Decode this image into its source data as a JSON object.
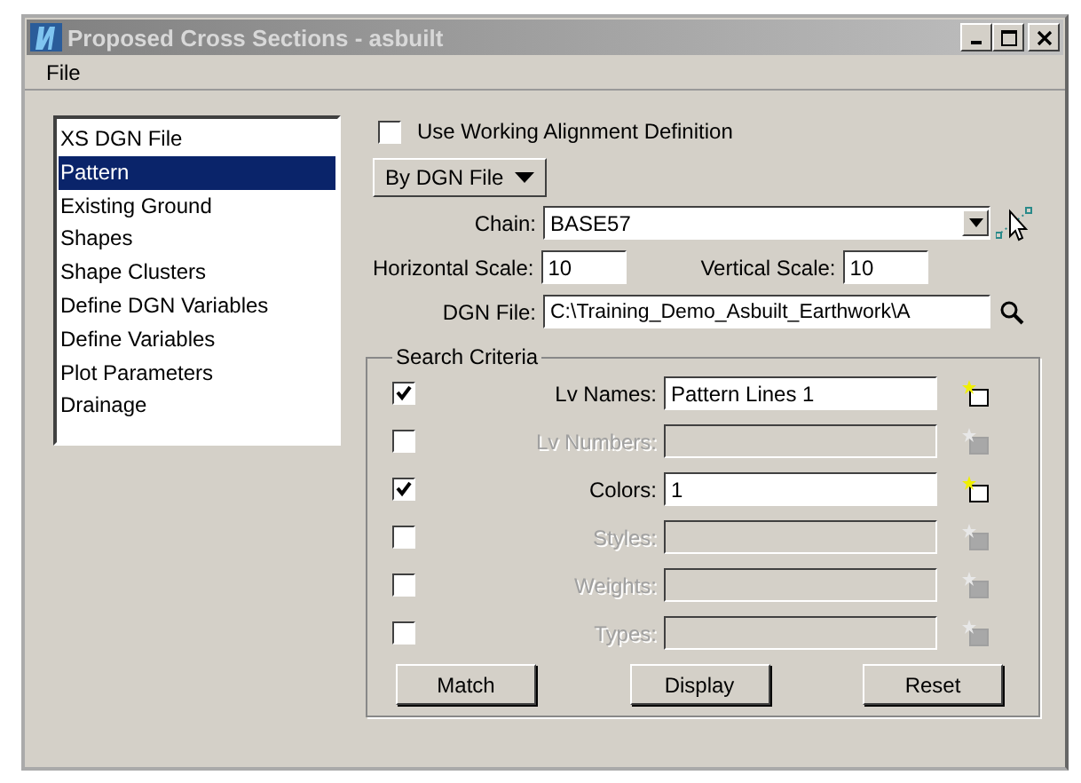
{
  "window": {
    "title": "Proposed Cross Sections - asbuilt"
  },
  "menu": [
    "File"
  ],
  "sidebar": {
    "items": [
      {
        "label": "XS DGN File",
        "selected": false
      },
      {
        "label": "Pattern",
        "selected": true
      },
      {
        "label": "Existing Ground",
        "selected": false
      },
      {
        "label": "Shapes",
        "selected": false
      },
      {
        "label": "Shape Clusters",
        "selected": false
      },
      {
        "label": "Define DGN Variables",
        "selected": false
      },
      {
        "label": "Define Variables",
        "selected": false
      },
      {
        "label": "Plot Parameters",
        "selected": false
      },
      {
        "label": "Drainage",
        "selected": false
      }
    ]
  },
  "use_working_alignment": {
    "label": "Use Working Alignment Definition",
    "checked": false
  },
  "mode_dropdown": {
    "value": "By DGN File"
  },
  "chain": {
    "label": "Chain:",
    "value": "BASE57"
  },
  "horizontal_scale": {
    "label": "Horizontal Scale:",
    "value": "10"
  },
  "vertical_scale": {
    "label": "Vertical Scale:",
    "value": "10"
  },
  "dgn_file": {
    "label": "DGN File:",
    "value": "C:\\Training_Demo_Asbuilt_Earthwork\\A"
  },
  "search_criteria": {
    "title": "Search Criteria",
    "rows": [
      {
        "label": "Lv Names:",
        "value": "Pattern Lines 1",
        "checked": true,
        "disabled": false
      },
      {
        "label": "Lv Numbers:",
        "checked": false,
        "disabled": true
      },
      {
        "label": "Colors:",
        "value": "1",
        "checked": true,
        "disabled": false
      },
      {
        "label": "Styles:",
        "checked": false,
        "disabled": true
      },
      {
        "label": "Weights:",
        "checked": false,
        "disabled": true
      },
      {
        "label": "Types:",
        "checked": false,
        "disabled": true
      }
    ],
    "buttons": [
      "Match",
      "Display",
      "Reset"
    ]
  }
}
